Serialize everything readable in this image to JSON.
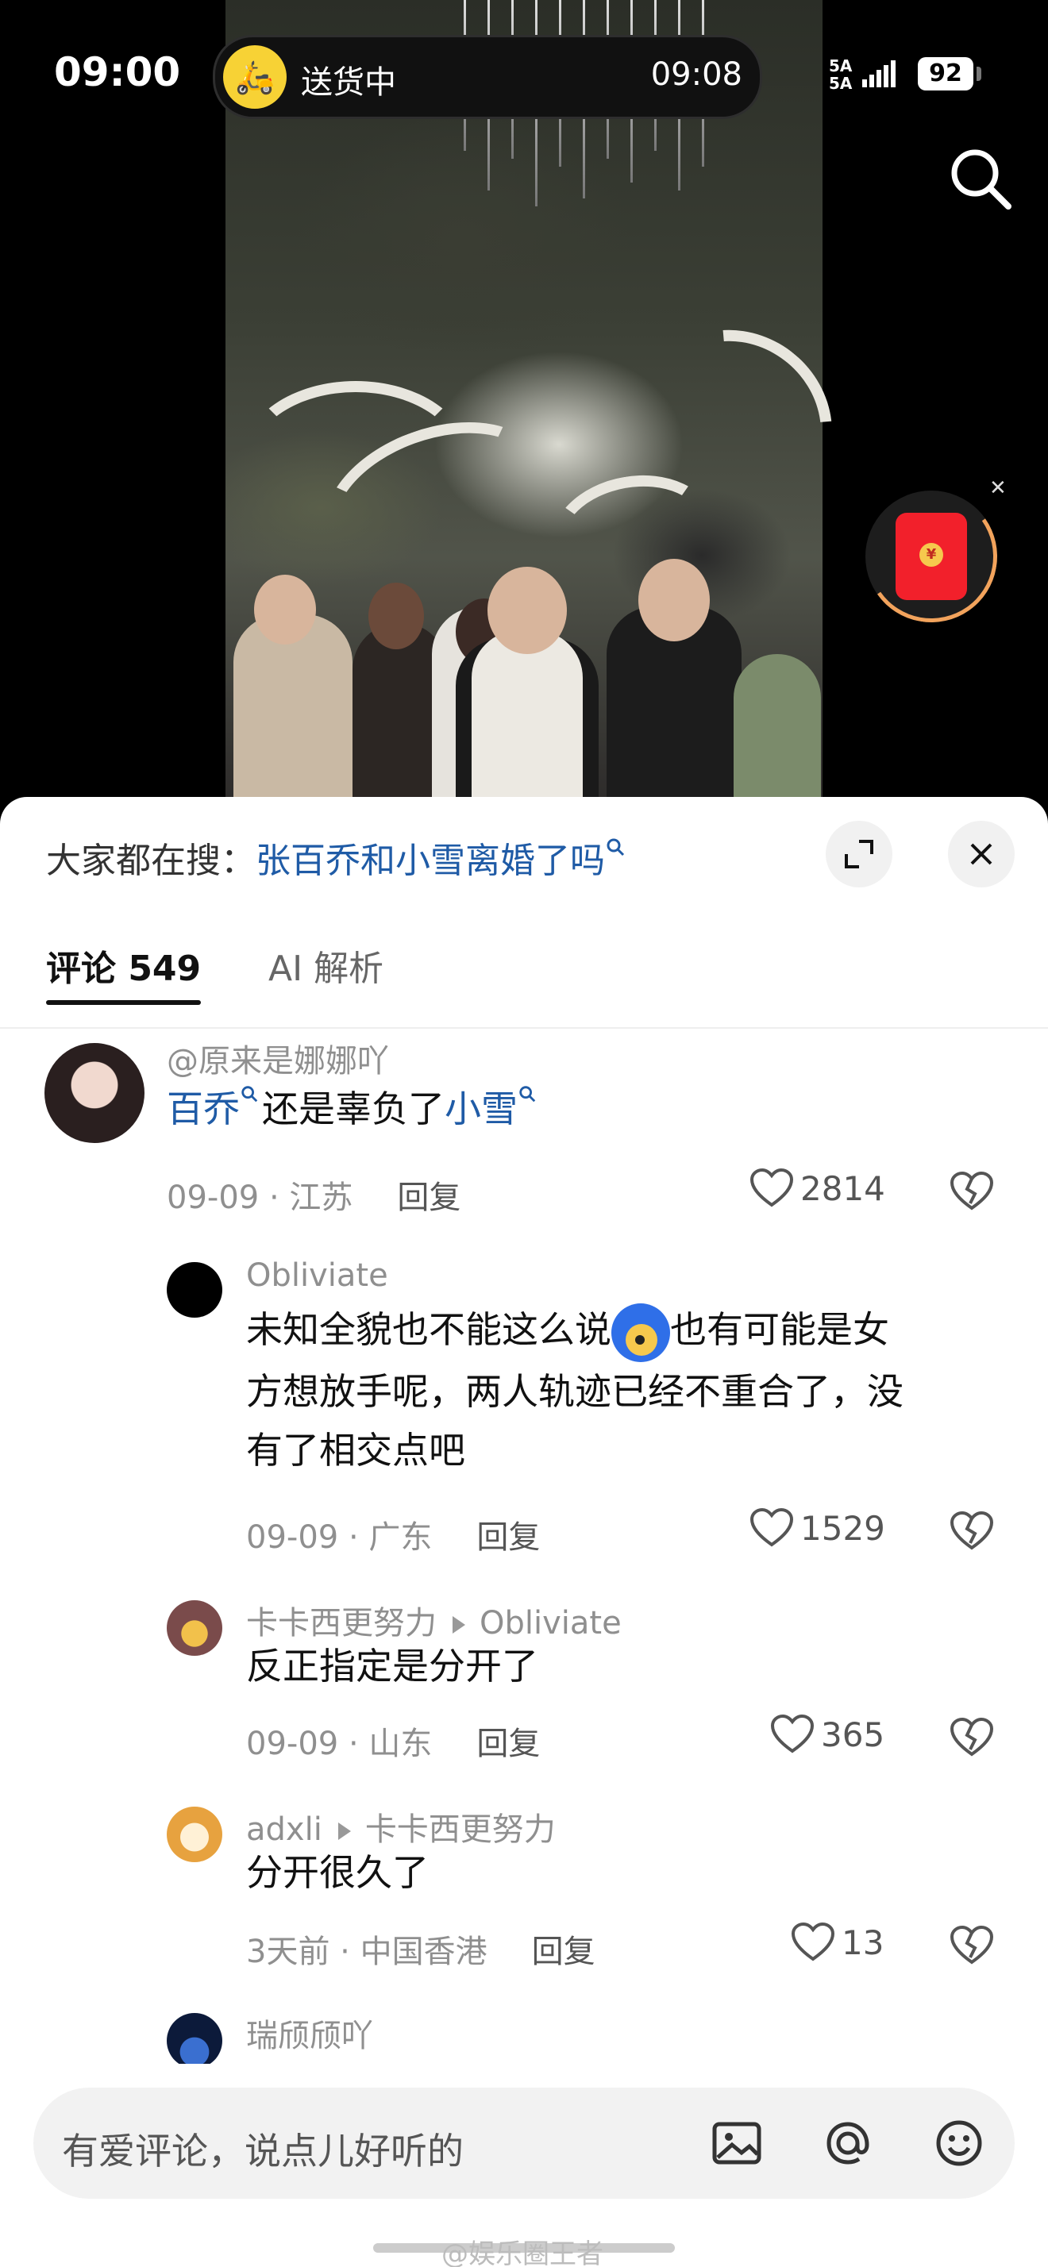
{
  "status_bar": {
    "time": "09:00",
    "live_activity_label": "送货中",
    "live_activity_time": "09:08",
    "signal_text_top": "5A",
    "signal_text_bottom": "5A",
    "battery": "92"
  },
  "search_suggestion": {
    "prefix": "大家都在搜：",
    "query": "张百乔和小雪离婚了吗"
  },
  "tabs": [
    {
      "label": "评论 549",
      "active": true
    },
    {
      "label": "AI 解析",
      "active": false
    }
  ],
  "comments": [
    {
      "user": "@原来是娜娜吖",
      "text_parts": [
        {
          "t": "百乔",
          "kw": true
        },
        {
          "t": "还是辜负了",
          "kw": false
        },
        {
          "t": "小雪",
          "kw": true
        }
      ],
      "date": "09-09",
      "location": "江苏",
      "reply": "回复",
      "likes": "2814"
    },
    {
      "user": "Obliviate",
      "text_line1a": "未知全貌也不能这么说",
      "text_line1b": "也有可能是女",
      "text_line2": "方想放手呢，两人轨迹已经不重合了，没",
      "text_line3": "有了相交点吧",
      "date": "09-09",
      "location": "广东",
      "reply": "回复",
      "likes": "1529"
    },
    {
      "user": "卡卡西更努力",
      "reply_to": "Obliviate",
      "text": "反正指定是分开了",
      "date": "09-09",
      "location": "山东",
      "reply": "回复",
      "likes": "365"
    },
    {
      "user": "adxli",
      "reply_to": "卡卡西更努力",
      "text": "分开很久了",
      "date": "3天前",
      "location": "中国香港",
      "reply": "回复",
      "likes": "13"
    },
    {
      "user": "瑞颀颀吖"
    }
  ],
  "input": {
    "placeholder": "有爱评论，说点儿好听的",
    "icons": [
      "image-icon",
      "at-icon",
      "emoji-icon"
    ]
  },
  "watermark": "@娱乐圈王者",
  "colors": {
    "keyword_blue": "#1f5ba6",
    "meta_gray": "#8f8f8f",
    "red_packet": "#f2202b"
  }
}
